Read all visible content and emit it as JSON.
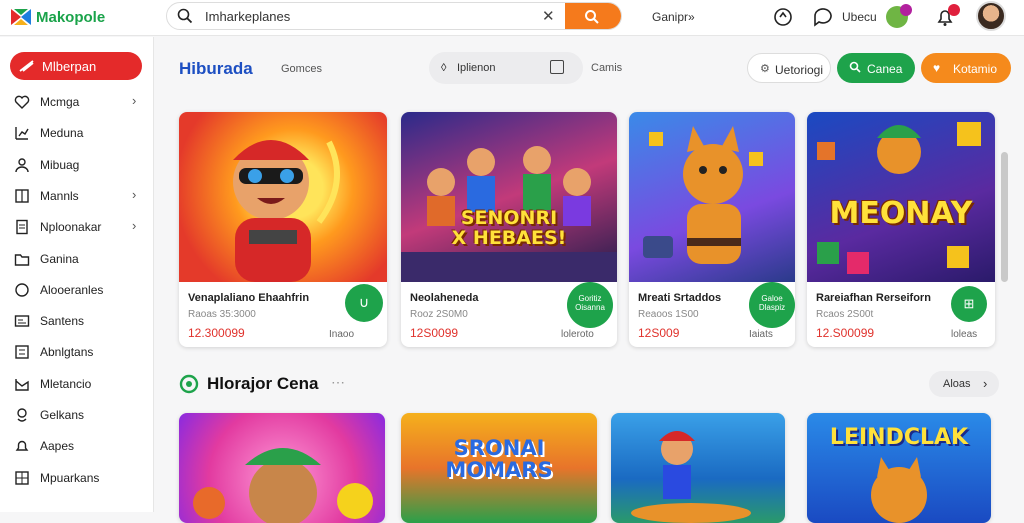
{
  "app": {
    "name": "Makopole"
  },
  "search": {
    "value": "Imharkeplanes",
    "placeholder": ""
  },
  "topbar": {
    "link1": "Ganipr»",
    "link2": "Ubecu"
  },
  "sidebar": {
    "primary": "Mlberpan",
    "items": [
      {
        "label": "Mcmga",
        "icon": "heart-icon",
        "chevron": true
      },
      {
        "label": "Meduna",
        "icon": "chart-icon",
        "chevron": false
      },
      {
        "label": "Mibuag",
        "icon": "user-icon",
        "chevron": false
      },
      {
        "label": "Mannls",
        "icon": "book-icon",
        "chevron": true
      },
      {
        "label": "Nploonakar",
        "icon": "doc-icon",
        "chevron": true
      },
      {
        "label": "Ganina",
        "icon": "folder-icon",
        "chevron": false
      },
      {
        "label": "Alooeranles",
        "icon": "circle-icon",
        "chevron": false
      },
      {
        "label": "Santens",
        "icon": "card-icon",
        "chevron": false
      },
      {
        "label": "Abnlgtans",
        "icon": "list-icon",
        "chevron": false
      },
      {
        "label": "Mletancio",
        "icon": "mail-icon",
        "chevron": false
      },
      {
        "label": "Gelkans",
        "icon": "pin-icon",
        "chevron": false
      },
      {
        "label": "Aapes",
        "icon": "bell-icon",
        "chevron": false
      },
      {
        "label": "Mpuarkans",
        "icon": "grid-icon",
        "chevron": false
      }
    ]
  },
  "header": {
    "title": "Hiburada",
    "subtitle": "Gomces",
    "filter_label": "Iplienon",
    "games_label": "Camis",
    "btn_outline": "Uetoriogi",
    "btn_green": "Canea",
    "btn_orange": "Kotamio"
  },
  "cards": [
    {
      "title": "Venaplaliano Ehaahfrin",
      "meta": "Raoas 35:3000",
      "price": "12.300099",
      "rating": "Inaoo",
      "play": "",
      "art_text": ""
    },
    {
      "title": "Neolaheneda",
      "meta": "Rooz 2S0M0",
      "price": "12S0099",
      "rating": "loleroto",
      "play": "Goritiz Oisanna",
      "art_text": "SENONRI\nX HEBAES!"
    },
    {
      "title": "Mreati Srtaddos",
      "meta": "Reaoos 1S00",
      "price": "12S009",
      "rating": "Iaiats",
      "play": "Galoe Dlaspiz",
      "art_text": ""
    },
    {
      "title": "Rareiafhan Rerseiforn",
      "meta": "Rcaos 2S00t",
      "price": "12.S00099",
      "rating": "loleas",
      "play": "",
      "art_text": "MEONAY"
    }
  ],
  "section": {
    "title": "Hlorajor Cena",
    "more": "Aloas"
  },
  "cards2": [
    {
      "art_text": ""
    },
    {
      "art_text": "SRONAI MOMARS"
    },
    {
      "art_text": ""
    },
    {
      "art_text": "LEINDCLAK"
    }
  ]
}
